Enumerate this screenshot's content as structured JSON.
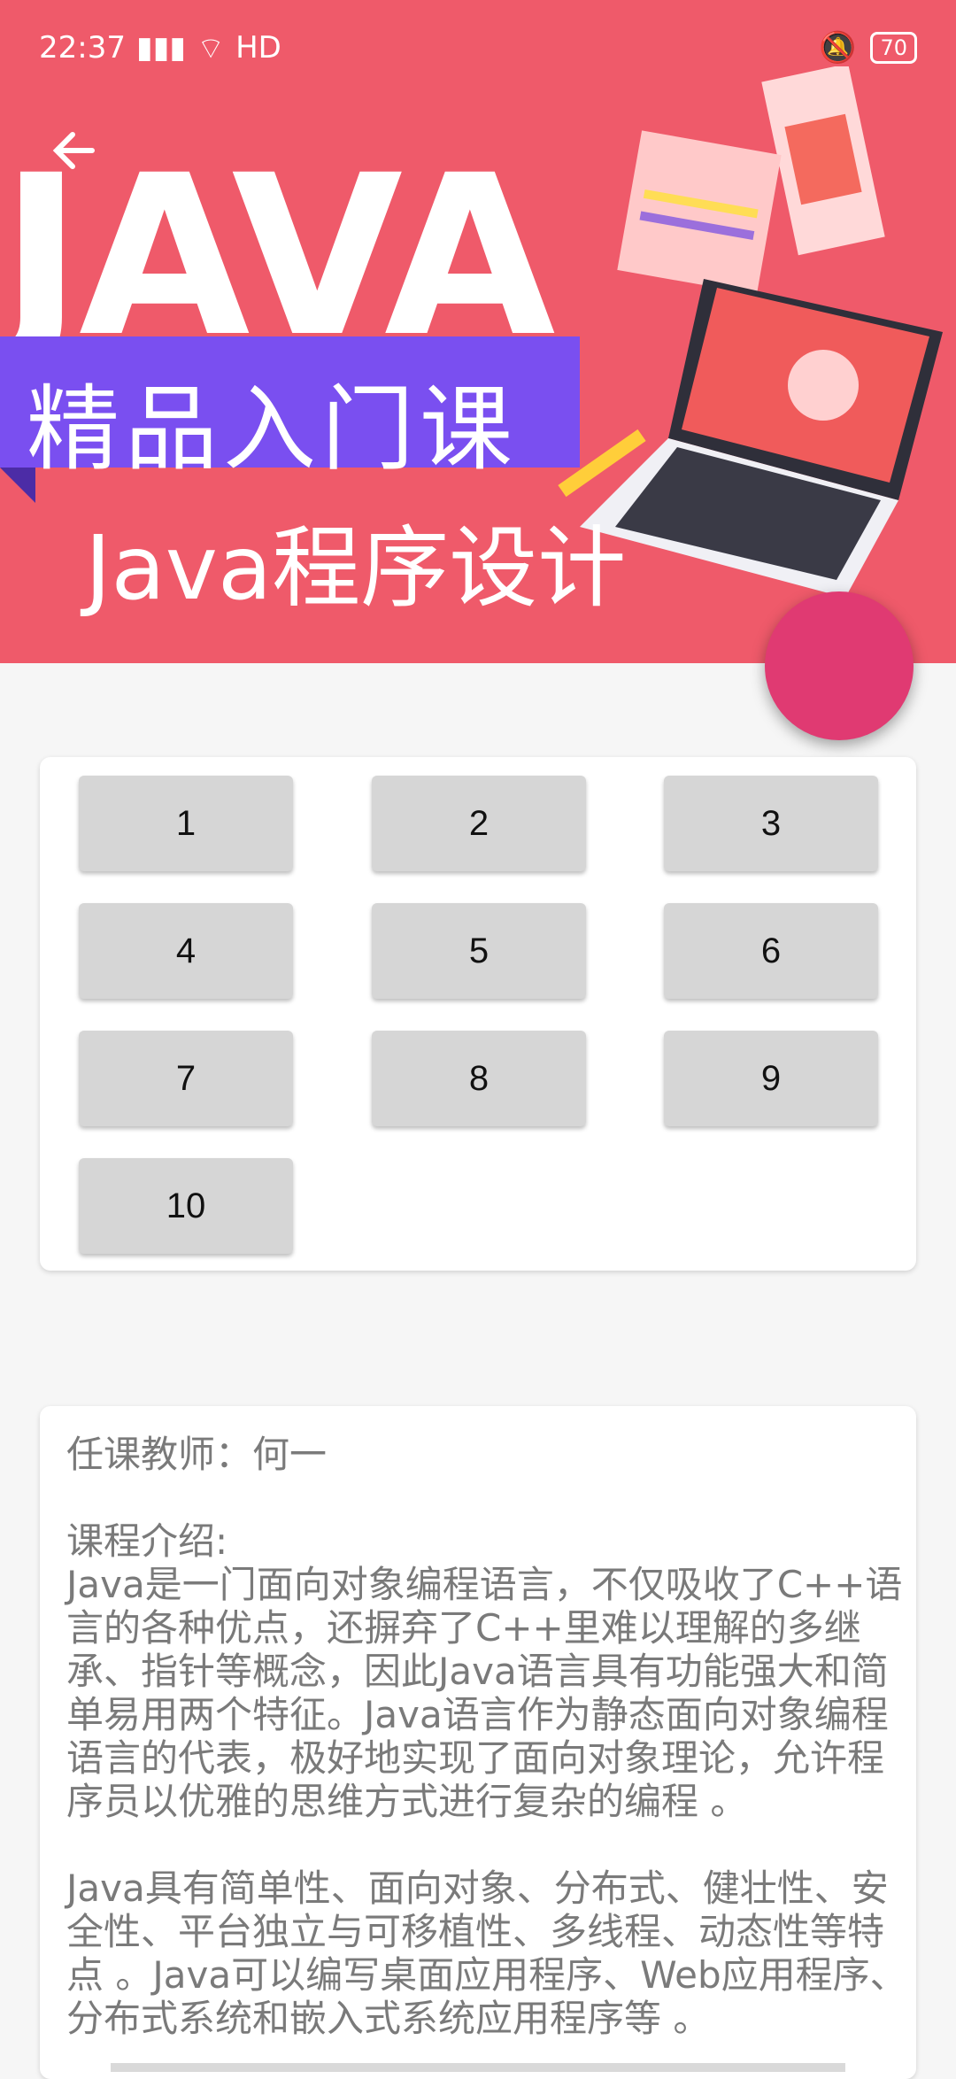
{
  "status": {
    "time": "22:37",
    "network": "HD",
    "battery": "70"
  },
  "header": {
    "banner_title": "JAVA",
    "banner_subtitle": "精品入门课",
    "course_name": "Java程序设计"
  },
  "lessons": [
    "1",
    "2",
    "3",
    "4",
    "5",
    "6",
    "7",
    "8",
    "9",
    "10"
  ],
  "details": {
    "teacher": "任课教师：何一",
    "intro_label": "课程介绍:",
    "intro_p1": "Java是一门面向对象编程语言，不仅吸收了C++语言的各种优点，还摒弃了C++里难以理解的多继承、指针等概念，因此Java语言具有功能强大和简单易用两个特征。Java语言作为静态面向对象编程语言的代表，极好地实现了面向对象理论，允许程序员以优雅的思维方式进行复杂的编程 。",
    "intro_p2": "Java具有简单性、面向对象、分布式、健壮性、安全性、平台独立与可移植性、多线程、动态性等特点 。Java可以编写桌面应用程序、Web应用程序、分布式系统和嵌入式系统应用程序等 。"
  }
}
